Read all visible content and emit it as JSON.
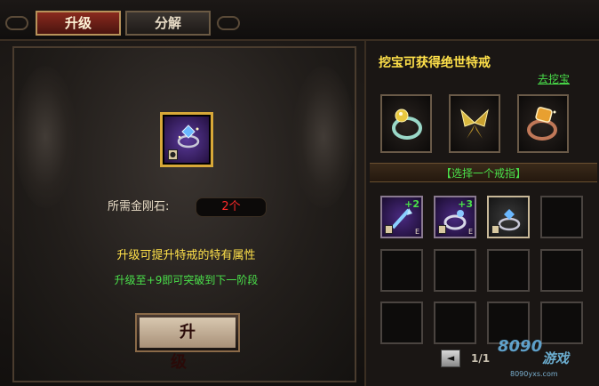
{
  "tabs": {
    "upgrade": "升级",
    "decompose": "分解"
  },
  "left": {
    "required_label": "所需金刚石:",
    "required_value": "2个",
    "info_line1": "升级可提升特戒的特有属性",
    "info_line2": "升级至+9即可突破到下一阶段",
    "upgrade_button": "升  级"
  },
  "right": {
    "title": "挖宝可获得绝世特戒",
    "dig_link": "去挖宝",
    "select_label": "【选择一个戒指】",
    "showcase_icons": [
      "pearl-ring-icon",
      "gold-butterfly-ring-icon",
      "amber-gem-ring-icon"
    ],
    "slots": [
      {
        "plus": "+2",
        "e": "E"
      },
      {
        "plus": "+3",
        "e": "E"
      },
      {
        "plus": "",
        "e": ""
      }
    ],
    "pagination": "1/1",
    "prev_icon": "◄"
  },
  "watermark": {
    "logo": "8090",
    "brand": "游戏",
    "url": "8090yxs.com"
  },
  "colors": {
    "accent_yellow": "#ffe14a",
    "accent_green": "#4ae04a",
    "required_red": "#ff2a2a",
    "tab_active": "#8a2a1e"
  }
}
